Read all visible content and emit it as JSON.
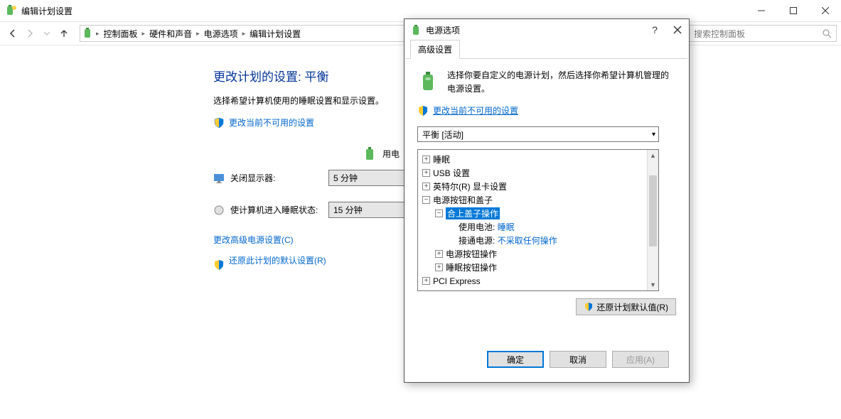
{
  "window": {
    "title": "编辑计划设置"
  },
  "breadcrumb": {
    "items": [
      "控制面板",
      "硬件和声音",
      "电源选项",
      "编辑计划设置"
    ]
  },
  "search": {
    "placeholder": "搜索控制面板"
  },
  "main": {
    "heading": "更改计划的设置: 平衡",
    "subheading": "选择希望计算机使用的睡眠设置和显示设置。",
    "unavailable_link": "更改当前不可用的设置",
    "col_battery": "用电",
    "row_display_off": "关闭显示器:",
    "row_sleep": "使计算机进入睡眠状态:",
    "val_display_off_battery": "5 分钟",
    "val_sleep_battery": "15 分钟",
    "adv_link": "更改高级电源设置(C)",
    "restore_link": "还原此计划的默认设置(R)"
  },
  "dialog": {
    "title": "电源选项",
    "tab": "高级设置",
    "intro": "选择你要自定义的电源计划，然后选择你希望计算机管理的电源设置。",
    "unavailable_link": "更改当前不可用的设置",
    "plan_selected": "平衡 [活动]",
    "tree": {
      "sleep": "睡眠",
      "usb": "USB 设置",
      "intel": "英特尔(R) 显卡设置",
      "power_btn_lid": "电源按钮和盖子",
      "lid_action": "合上盖子操作",
      "on_battery_label": "使用电池:",
      "on_battery_value": "睡眠",
      "plugged_label": "接通电源:",
      "plugged_value": "不采取任何操作",
      "power_btn": "电源按钮操作",
      "sleep_btn": "睡眠按钮操作",
      "pci": "PCI Express"
    },
    "restore_defaults": "还原计划默认值(R)",
    "ok": "确定",
    "cancel": "取消",
    "apply": "应用(A)"
  }
}
